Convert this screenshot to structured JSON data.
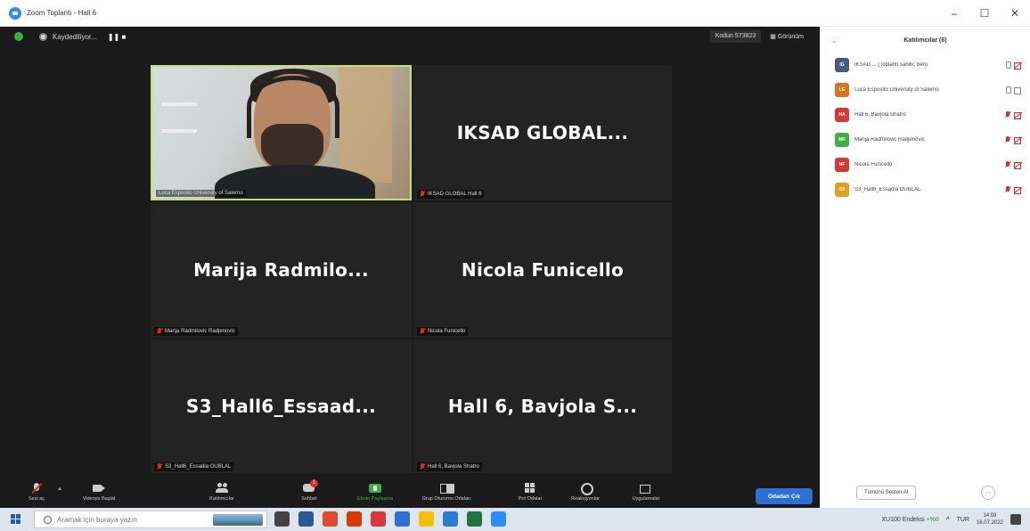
{
  "window": {
    "title": "Zoom Toplantı - Hall 6",
    "controls": [
      "–",
      "☐",
      "✕"
    ]
  },
  "topbar": {
    "recording_label": "Kaydediliyor...",
    "recording_controls": "❚❚  ■",
    "meeting_id_label": "Kodun 573823",
    "view_label": "▦ Görünüm"
  },
  "tiles": [
    {
      "id": "luca",
      "big_name": "",
      "label": "Luca Esposito University of Salerno",
      "active": true
    },
    {
      "id": "iksad",
      "big_name": "IKSAD GLOBAL...",
      "label": "IKSAD GLOBAL Hall 6"
    },
    {
      "id": "marija",
      "big_name": "Marija Radmilo...",
      "label": "Marija Radmilovic Radjenovic"
    },
    {
      "id": "nicola",
      "big_name": "Nicola Funicello",
      "label": "Nicola Funicello"
    },
    {
      "id": "s3",
      "big_name": "S3_Hall6_Essaad...",
      "label": "S3_Hall6_Essadia OUBLAL"
    },
    {
      "id": "bavjola",
      "big_name": "Hall 6, Bavjola S...",
      "label": "Hall 6, Bavjola Shatro"
    }
  ],
  "toolbar": {
    "mute_label": "Sesi aç",
    "video_label": "Videoyu Başlat",
    "participants_label": "Katılımcılar",
    "participants_count": "6",
    "chat_label": "Sohbet",
    "chat_badge": "1",
    "share_label": "Ekran Paylaşma",
    "breakout_label": "Grup Oturumu Odaları",
    "apps_label": "Pro Odalar",
    "reactions_label": "Reaksiyonlar",
    "more_label": "Uygulamalar",
    "leave_label": "Odadan Çık"
  },
  "panel": {
    "title": "Katılımcılar (6)",
    "participants": [
      {
        "initials": "IG",
        "name": "IKSAD ... (Toplantı sahibi, ben)",
        "color": "#4a5b7a",
        "mic": "on",
        "cam": "off"
      },
      {
        "initials": "LE",
        "name": "Luca Esposito University of Salerno",
        "color": "#d9731f",
        "mic": "on",
        "cam": "on"
      },
      {
        "initials": "HA",
        "name": "Hall 6, Bavjola Shatro",
        "color": "#d23a3a",
        "mic": "off",
        "cam": "off"
      },
      {
        "initials": "MR",
        "name": "Marija Radmilovic Radjenovic",
        "color": "#3cb043",
        "mic": "off",
        "cam": "off"
      },
      {
        "initials": "NF",
        "name": "Nicola Funicello",
        "color": "#d23a3a",
        "mic": "off",
        "cam": "off"
      },
      {
        "initials": "S3",
        "name": "S3_Hall6_Essadia OUBLAL",
        "color": "#e0a020",
        "mic": "off",
        "cam": "off"
      }
    ],
    "invite_label": "Tümünü Sesten Al",
    "more_label": "···"
  },
  "taskbar": {
    "search_placeholder": "Aramak için buraya yazın",
    "stock_label": "XU100 Endeksi",
    "stock_delta": "+%0",
    "lang": "TUR",
    "time": "14:08",
    "date": "16.07.2022",
    "app_colors": [
      "#444444",
      "#2b5797",
      "#e04a2e",
      "#d83b01",
      "#d9363e",
      "#2d6fd4",
      "#f2c200",
      "#2b7cd3",
      "#217346",
      "#2d8cff"
    ]
  }
}
